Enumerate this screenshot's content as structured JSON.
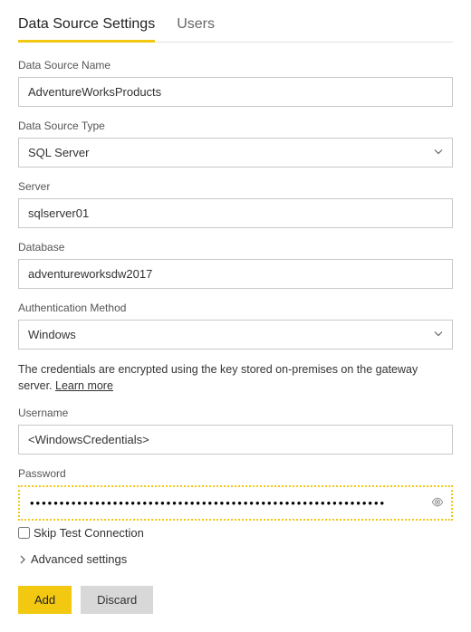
{
  "tabs": {
    "settings": "Data Source Settings",
    "users": "Users"
  },
  "fields": {
    "dsname_label": "Data Source Name",
    "dsname_value": "AdventureWorksProducts",
    "dstype_label": "Data Source Type",
    "dstype_value": "SQL Server",
    "server_label": "Server",
    "server_value": "sqlserver01",
    "database_label": "Database",
    "database_value": "adventureworksdw2017",
    "authmethod_label": "Authentication Method",
    "authmethod_value": "Windows",
    "username_label": "Username",
    "username_value": "<WindowsCredentials>",
    "password_label": "Password",
    "password_value": "••••••••••••••••••••••••••••••••••••••••••••••••••••••••••••"
  },
  "info": {
    "text": "The credentials are encrypted using the key stored on-premises on the gateway server. ",
    "link": "Learn more"
  },
  "skip": {
    "label": "Skip Test Connection"
  },
  "advanced": {
    "label": "Advanced settings"
  },
  "buttons": {
    "add": "Add",
    "discard": "Discard"
  }
}
